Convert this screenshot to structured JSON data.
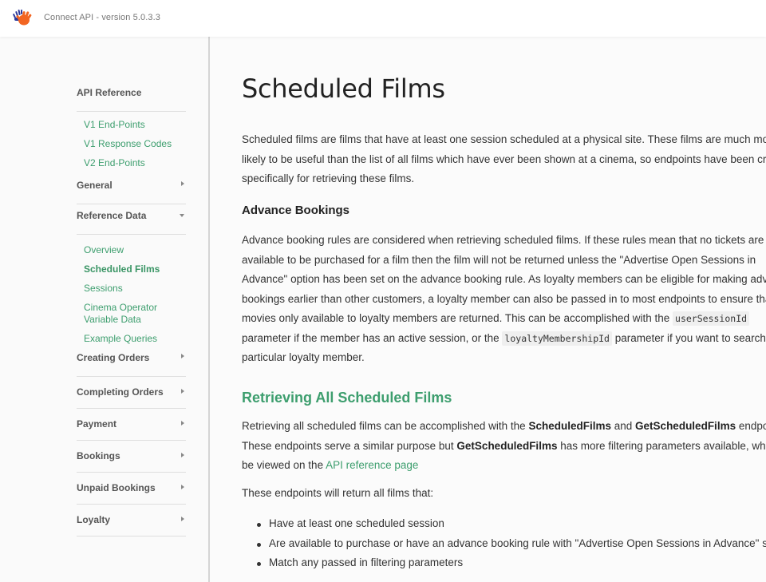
{
  "header": {
    "app_title": "Connect API - version 5.0.3.3",
    "logo_icon": "waving-hands-logo"
  },
  "colors": {
    "accent_green": "#3d9e6e",
    "logo_orange": "#f26522",
    "logo_blue": "#2d3a9b"
  },
  "sidebar": {
    "sections": [
      {
        "label": "API Reference",
        "caret": "none",
        "items": [
          "V1 End-Points",
          "V1 Response Codes",
          "V2 End-Points"
        ]
      },
      {
        "label": "General",
        "caret": "right"
      },
      {
        "label": "Reference Data",
        "caret": "down",
        "items": [
          "Overview",
          "Scheduled Films",
          "Sessions",
          "Cinema Operator Variable Data",
          "Example Queries"
        ],
        "active_item": "Scheduled Films"
      },
      {
        "label": "Creating Orders",
        "caret": "right"
      },
      {
        "label": "Completing Orders",
        "caret": "right"
      },
      {
        "label": "Payment",
        "caret": "right"
      },
      {
        "label": "Bookings",
        "caret": "right"
      },
      {
        "label": "Unpaid Bookings",
        "caret": "right"
      },
      {
        "label": "Loyalty",
        "caret": "right"
      }
    ]
  },
  "main": {
    "title": "Scheduled Films",
    "intro": "Scheduled films are films that have at least one session scheduled at a physical site. These films are much more likely to be useful than the list of all films which have ever been shown at a cinema, so endpoints have been created specifically for retrieving these films.",
    "advance": {
      "heading": "Advance Bookings",
      "text_1": "Advance booking rules are considered when retrieving scheduled films. If these rules mean that no tickets are available to be purchased for a film then the film will not be returned unless the \"Advertise Open Sessions in Advance\" option has been set on the advance booking rule. As loyalty members can be eligible for making advance bookings earlier than other customers, a loyalty member can also be passed in to most endpoints to ensure that movies only available to loyalty members are returned. This can be accomplished with the",
      "code_1": "userSessionId",
      "text_2": "parameter if the member has an active session, or the",
      "code_2": "loyaltyMembershipId",
      "text_3": "parameter if you want to search as a particular loyalty member."
    },
    "retrieving": {
      "heading": "Retrieving All Scheduled Films",
      "t1": "Retrieving all scheduled films can be accomplished with the",
      "b1": "ScheduledFilms",
      "t2": "and",
      "b2": "GetScheduledFilms",
      "t3": "endpoints. These endpoints serve a similar purpose but",
      "b3": "GetScheduledFilms",
      "t4": "has more filtering parameters available, which can be viewed on the",
      "link": "API reference page",
      "returns_intro": "These endpoints will return all films that:",
      "bullets": [
        "Have at least one scheduled session",
        "Are available to purchase or have an advance booking rule with \"Advertise Open Sessions in Advance\" set",
        "Match any passed in filtering parameters"
      ]
    }
  }
}
